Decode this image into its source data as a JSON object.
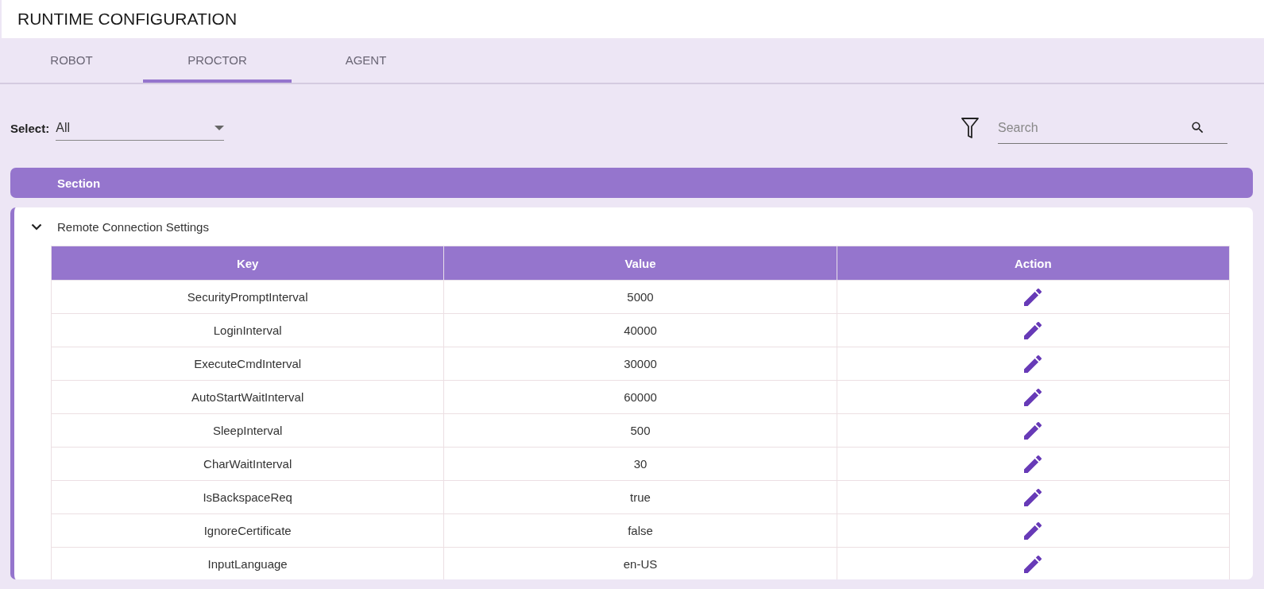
{
  "header": {
    "title": "RUNTIME CONFIGURATION"
  },
  "tabs": [
    {
      "label": "ROBOT",
      "selected": false
    },
    {
      "label": "PROCTOR",
      "selected": true
    },
    {
      "label": "AGENT",
      "selected": false
    }
  ],
  "select": {
    "label": "Select:",
    "value": "All"
  },
  "search": {
    "placeholder": "Search"
  },
  "section_header": "Section",
  "sections": [
    {
      "title": "Remote Connection Settings",
      "expanded": true,
      "table": {
        "columns": [
          "Key",
          "Value",
          "Action"
        ],
        "rows": [
          {
            "key": "SecurityPromptInterval",
            "value": "5000"
          },
          {
            "key": "LoginInterval",
            "value": "40000"
          },
          {
            "key": "ExecuteCmdInterval",
            "value": "30000"
          },
          {
            "key": "AutoStartWaitInterval",
            "value": "60000"
          },
          {
            "key": "SleepInterval",
            "value": "500"
          },
          {
            "key": "CharWaitInterval",
            "value": "30"
          },
          {
            "key": "IsBackspaceReq",
            "value": "true"
          },
          {
            "key": "IgnoreCertificate",
            "value": "false"
          },
          {
            "key": "InputLanguage",
            "value": "en-US"
          }
        ]
      }
    }
  ]
}
